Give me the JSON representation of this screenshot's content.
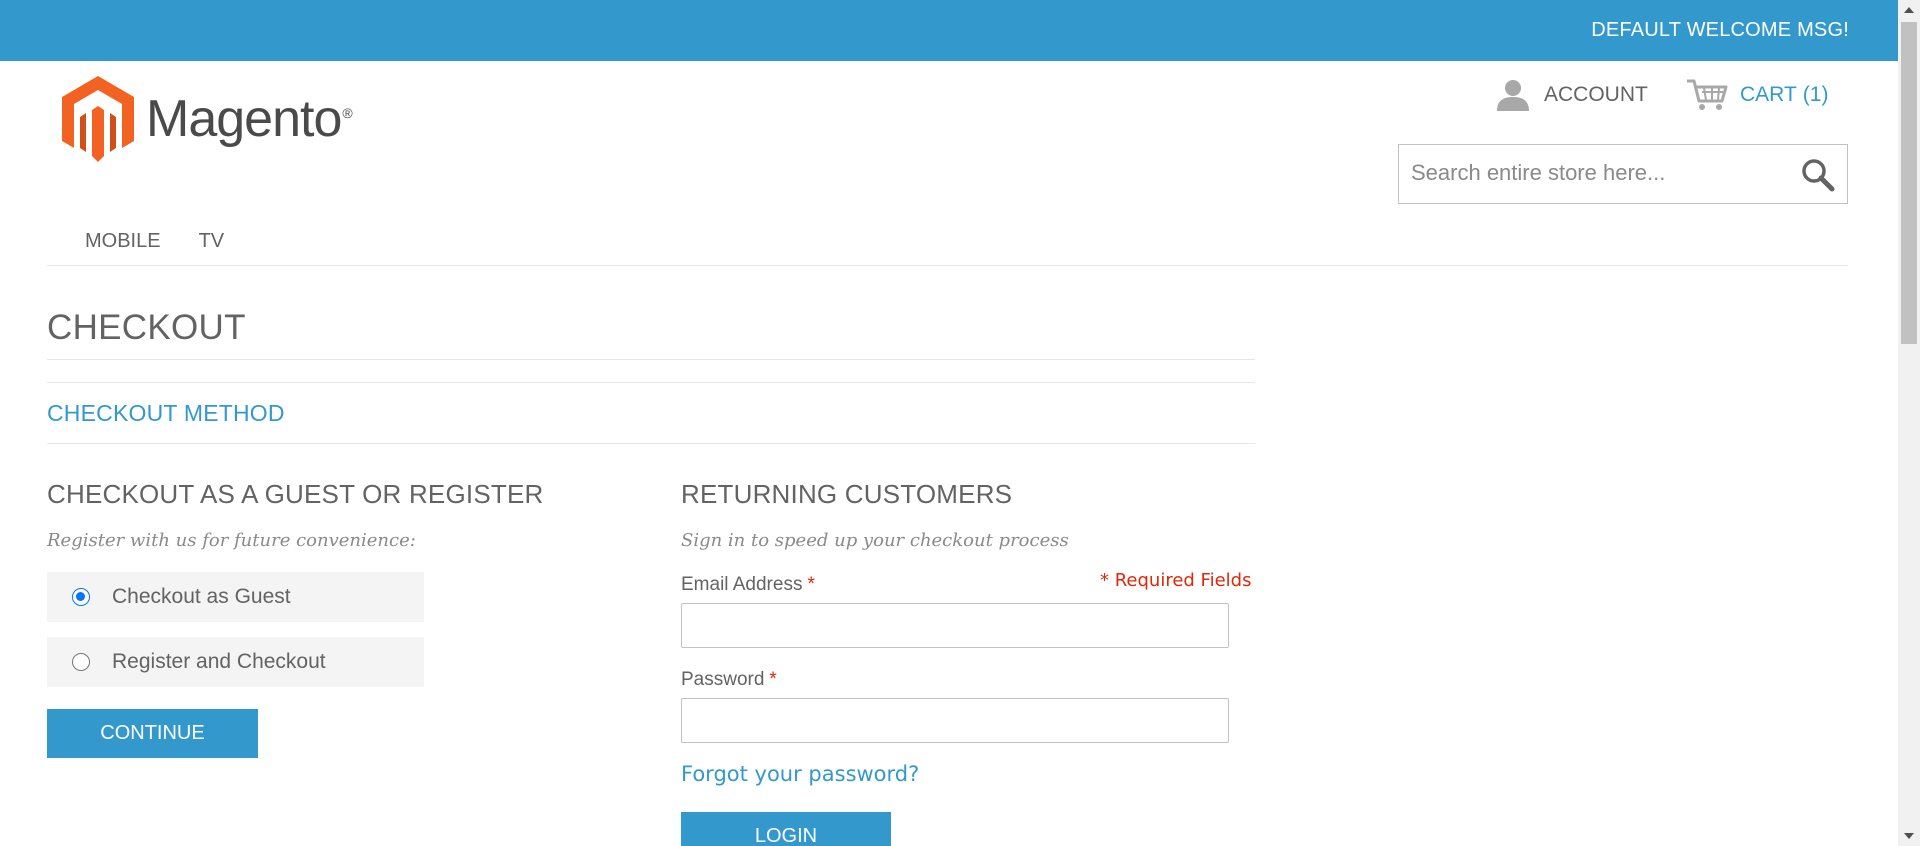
{
  "topbar": {
    "welcome": "DEFAULT WELCOME MSG!"
  },
  "header": {
    "logo_text": "Magento",
    "logo_mark": "®",
    "account_label": "ACCOUNT",
    "cart_label": "CART",
    "cart_count": "(1)"
  },
  "search": {
    "placeholder": "Search entire store here...",
    "value": ""
  },
  "nav": {
    "items": [
      {
        "label": "MOBILE"
      },
      {
        "label": "TV"
      }
    ]
  },
  "page": {
    "title": "CHECKOUT",
    "section_title": "CHECKOUT METHOD"
  },
  "guest": {
    "title": "CHECKOUT AS A GUEST OR REGISTER",
    "subtitle": "Register with us for future convenience:",
    "options": [
      {
        "label": "Checkout as Guest",
        "selected": true
      },
      {
        "label": "Register and Checkout",
        "selected": false
      }
    ],
    "continue_label": "CONTINUE"
  },
  "returning": {
    "title": "RETURNING CUSTOMERS",
    "subtitle": "Sign in to speed up your checkout process",
    "email_label": "Email Address",
    "password_label": "Password",
    "required_star": "*",
    "required_note": "* Required Fields",
    "email_value": "",
    "password_value": "",
    "forgot_label": "Forgot your password?",
    "login_label": "LOGIN"
  },
  "colors": {
    "accent": "#3399cc",
    "required": "#df280a",
    "text": "#636363"
  }
}
